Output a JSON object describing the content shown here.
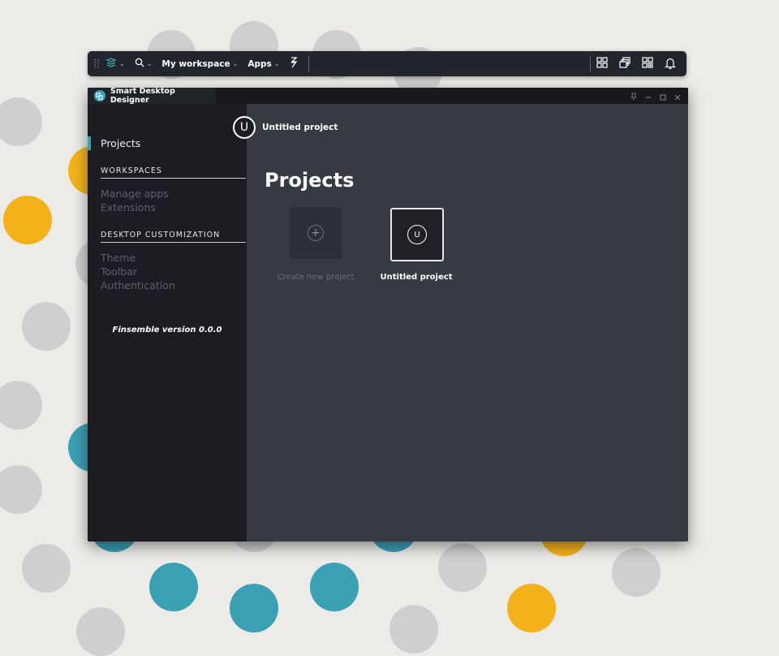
{
  "toolbar": {
    "workspace_label": "My workspace",
    "apps_label": "Apps",
    "icons": [
      "drag-handle-icon",
      "finsemble-logo-icon",
      "search-icon",
      "snap-icon",
      "tile-icon",
      "cascade-icon",
      "groups-icon",
      "bell-icon"
    ]
  },
  "window": {
    "title": "Smart Desktop Designer",
    "controls": [
      "pin-icon",
      "minimize-icon",
      "maximize-icon",
      "close-icon"
    ]
  },
  "sidebar": {
    "active_item": "Projects",
    "sections": [
      {
        "heading": "WORKSPACES",
        "items": [
          "Manage apps",
          "Extensions"
        ]
      },
      {
        "heading": "DESKTOP CUSTOMIZATION",
        "items": [
          "Theme",
          "Toolbar",
          "Authentication"
        ]
      }
    ],
    "version": "Finsemble version 0.0.0"
  },
  "content": {
    "current_project_initial": "U",
    "current_project_name": "Untitled project",
    "title": "Projects",
    "new_card_label": "Create new project",
    "project_card_initial": "U",
    "project_card_label": "Untitled project"
  },
  "colors": {
    "accent": "#3aa0b4",
    "toolbar_bg": "#22252b",
    "sidebar_bg": "#1b1d22",
    "content_bg": "#363a42",
    "yellow_dot": "#f3b21a",
    "gray_dot": "#cfcfcf"
  }
}
